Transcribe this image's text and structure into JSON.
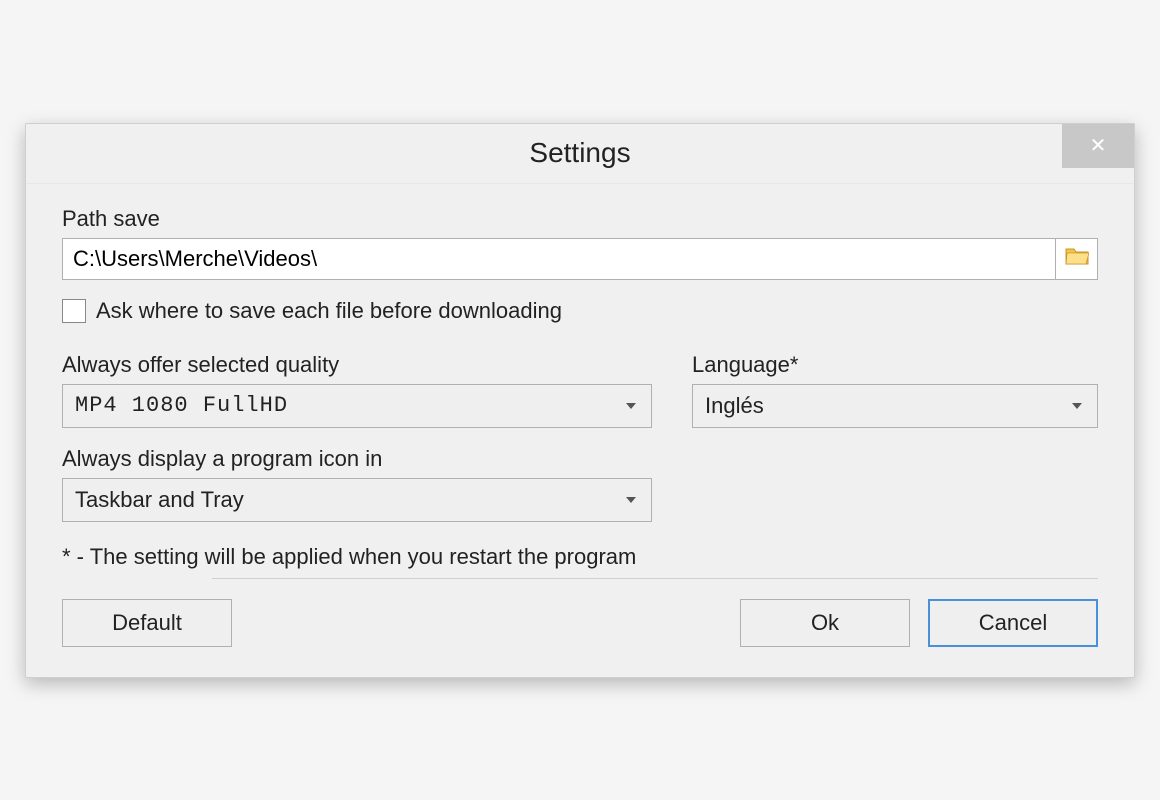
{
  "window": {
    "title": "Settings",
    "close_glyph": "✕"
  },
  "path": {
    "label": "Path save",
    "value": "C:\\Users\\Merche\\Videos\\"
  },
  "ask_save": {
    "label": "Ask where to save each file before downloading",
    "checked": false
  },
  "quality": {
    "label": "Always offer selected quality",
    "value": "MP4 1080 FullHD"
  },
  "language": {
    "label": "Language*",
    "value": "Inglés"
  },
  "display_icon": {
    "label": "Always display a program icon in",
    "value": "Taskbar and Tray"
  },
  "footnote": "* - The setting will be applied when you restart the program",
  "buttons": {
    "default": "Default",
    "ok": "Ok",
    "cancel": "Cancel"
  }
}
